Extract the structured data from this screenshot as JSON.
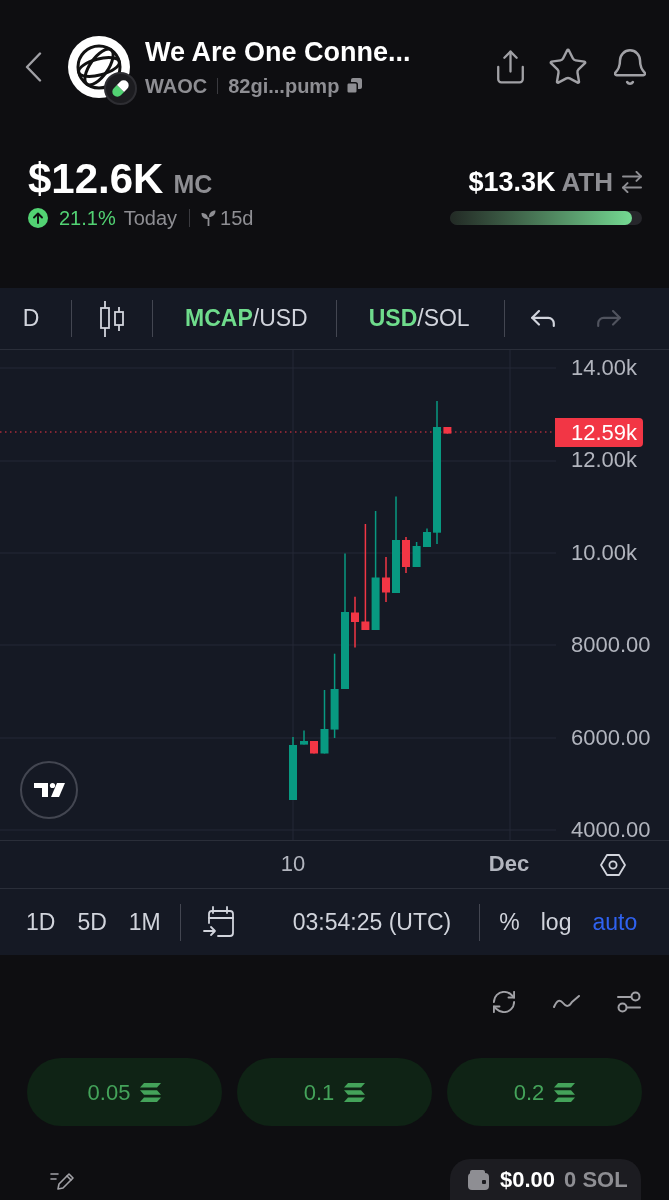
{
  "header": {
    "title": "We Are One Conne...",
    "symbol": "WAOC",
    "address": "82gi...pump"
  },
  "stats": {
    "market_cap": "$12.6K",
    "market_cap_label": "MC",
    "change": {
      "rising": true,
      "value": "21.1%",
      "period": "Today"
    },
    "age": "15d",
    "ath": {
      "value": "$13.3K",
      "label": "ATH",
      "level": 0.95
    }
  },
  "chart": {
    "toolbar": {
      "interval": "D",
      "pairs": [
        {
          "separator": "/",
          "options": [
            {
              "label": "MCAP",
              "selected": true
            },
            {
              "label": "USD",
              "selected": false
            }
          ]
        },
        {
          "separator": "/",
          "options": [
            {
              "label": "USD",
              "selected": true
            },
            {
              "label": "SOL",
              "selected": false
            }
          ]
        }
      ],
      "undo": {
        "disabled": false
      },
      "redo": {
        "disabled": true
      }
    },
    "price_axis": [
      "14.00k",
      "12.00k",
      "10.00k",
      "8000.00",
      "6000.00",
      "4000.00"
    ],
    "last_price": "12.59k",
    "time_axis": [
      {
        "label": "10",
        "kind": "day"
      },
      {
        "label": "Dec",
        "kind": "month"
      }
    ],
    "ranges": [
      {
        "label": "1D",
        "selected": false
      },
      {
        "label": "5D",
        "selected": false
      },
      {
        "label": "1M",
        "selected": false
      }
    ],
    "time": "03:54:25 (UTC)",
    "scales": [
      {
        "label": "%",
        "on": false
      },
      {
        "label": "log",
        "on": false
      },
      {
        "label": "auto",
        "on": true
      }
    ]
  },
  "quick_buys": [
    "0.05",
    "0.1",
    "0.2"
  ],
  "wallet": {
    "balance": "$0.00",
    "sol": "0 SOL"
  }
}
